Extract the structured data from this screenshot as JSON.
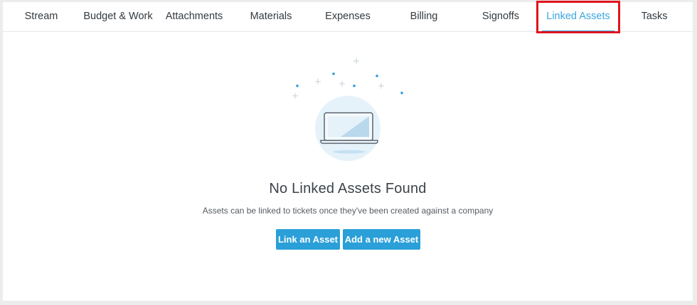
{
  "tabs": [
    {
      "label": "Stream",
      "active": false
    },
    {
      "label": "Budget & Work",
      "active": false
    },
    {
      "label": "Attachments",
      "active": false
    },
    {
      "label": "Materials",
      "active": false
    },
    {
      "label": "Expenses",
      "active": false
    },
    {
      "label": "Billing",
      "active": false
    },
    {
      "label": "Signoffs",
      "active": false
    },
    {
      "label": "Linked Assets",
      "active": true
    },
    {
      "label": "Tasks",
      "active": false
    }
  ],
  "empty_state": {
    "title": "No Linked Assets Found",
    "description": "Assets can be linked to tickets once they've been created against a company",
    "illustration_icon": "laptop-icon"
  },
  "actions": {
    "link_label": "Link an Asset",
    "add_label": "Add a new Asset"
  },
  "colors": {
    "accent": "#3aa7de",
    "button": "#2a9fd8",
    "highlight": "#e0141e"
  }
}
